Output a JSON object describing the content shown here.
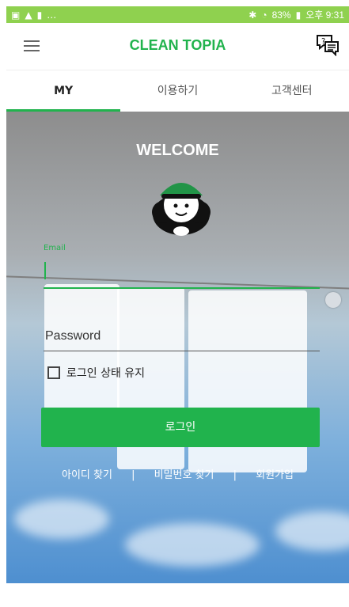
{
  "statusbar": {
    "left_icons": [
      "cast-icon",
      "warning-icon",
      "signal-icon",
      "more-icon"
    ],
    "right_text": "83%",
    "time": "오후 9:31"
  },
  "appbar": {
    "title": "CLEAN TOPIA"
  },
  "tabs": [
    {
      "label": "MY"
    },
    {
      "label": "이용하기"
    },
    {
      "label": "고객센터"
    }
  ],
  "hero": {
    "welcome": "WELCOME"
  },
  "form": {
    "email_label": "Email",
    "email_value": "",
    "password_placeholder": "Password",
    "remember_label": "로그인 상태 유지",
    "login_button": "로그인"
  },
  "links": {
    "find_id": "아이디 찾기",
    "sep1": "|",
    "find_pw": "비밀번호 찾기",
    "sep2": "|",
    "signup": "회원가입"
  },
  "colors": {
    "brand": "#21b34d",
    "statusbar": "#8fd14f"
  }
}
